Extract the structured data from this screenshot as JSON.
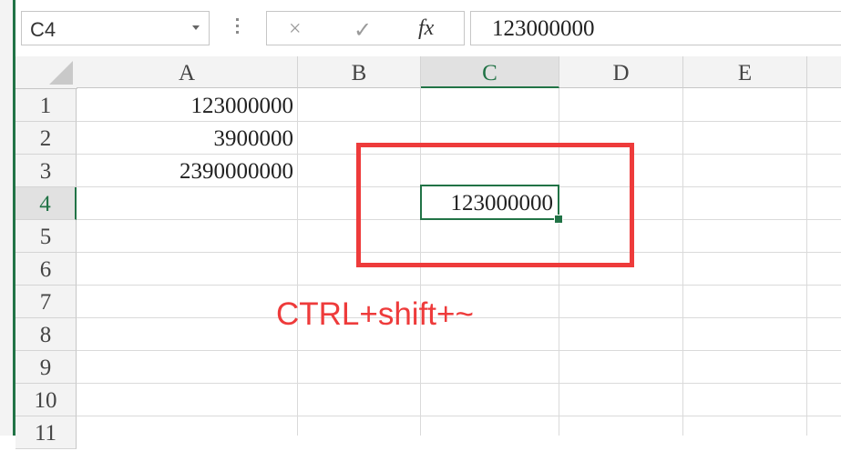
{
  "name_box": {
    "value": "C4"
  },
  "formula_bar": {
    "cancel_icon": "×",
    "enter_icon": "✓",
    "fx_label": "fx",
    "value": "123000000"
  },
  "columns": [
    "A",
    "B",
    "C",
    "D",
    "E"
  ],
  "selected_column": "C",
  "rows": [
    "1",
    "2",
    "3",
    "4",
    "5",
    "6",
    "7",
    "8",
    "9",
    "10",
    "11"
  ],
  "selected_row": "4",
  "cells": {
    "A1": "123000000",
    "A2": "3900000",
    "A3": "2390000000",
    "C4": "123000000"
  },
  "annotation": {
    "text": "CTRL+shift+~",
    "color": "#ee3b3b"
  },
  "colors": {
    "accent": "#217346",
    "header_bg": "#f3f3f3",
    "gridline": "#dadada"
  }
}
